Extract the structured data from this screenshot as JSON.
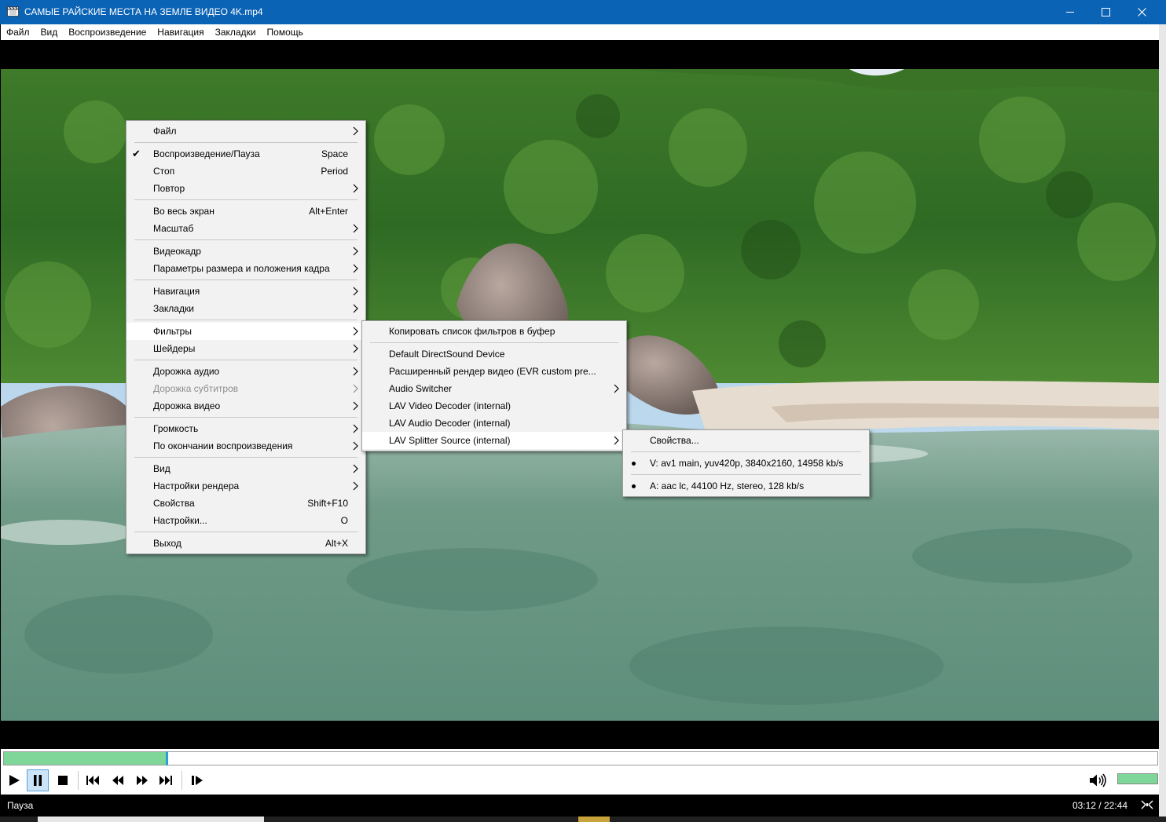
{
  "window": {
    "title": "САМЫЕ РАЙСКИЕ МЕСТА НА ЗЕМЛЕ ВИДЕО 4K.mp4",
    "app_icon": "film-clapper-icon",
    "controls": [
      "minimize-icon",
      "maximize-icon",
      "close-icon"
    ]
  },
  "menubar": {
    "items": [
      "Файл",
      "Вид",
      "Воспроизведение",
      "Навигация",
      "Закладки",
      "Помощь"
    ]
  },
  "context_menu": {
    "items": [
      {
        "label": "Файл",
        "submenu": true
      },
      {
        "label": "Воспроизведение/Пауза",
        "shortcut": "Space",
        "checked": true
      },
      {
        "label": "Стоп",
        "shortcut": "Period"
      },
      {
        "label": "Повтор",
        "submenu": true
      },
      {
        "label": "Во весь экран",
        "shortcut": "Alt+Enter"
      },
      {
        "label": "Масштаб",
        "submenu": true
      },
      {
        "label": "Видеокадр",
        "submenu": true
      },
      {
        "label": "Параметры размера и положения кадра",
        "submenu": true
      },
      {
        "label": "Навигация",
        "submenu": true
      },
      {
        "label": "Закладки",
        "submenu": true
      },
      {
        "label": "Фильтры",
        "submenu": true,
        "highlighted": true
      },
      {
        "label": "Шейдеры",
        "submenu": true
      },
      {
        "label": "Дорожка аудио",
        "submenu": true
      },
      {
        "label": "Дорожка субтитров",
        "submenu": true,
        "disabled": true
      },
      {
        "label": "Дорожка видео",
        "submenu": true
      },
      {
        "label": "Громкость",
        "submenu": true
      },
      {
        "label": "По окончании воспроизведения",
        "submenu": true
      },
      {
        "label": "Вид",
        "submenu": true
      },
      {
        "label": "Настройки рендера",
        "submenu": true
      },
      {
        "label": "Свойства",
        "shortcut": "Shift+F10"
      },
      {
        "label": "Настройки...",
        "shortcut": "O"
      },
      {
        "label": "Выход",
        "shortcut": "Alt+X"
      }
    ]
  },
  "filters_menu": {
    "items": [
      {
        "label": "Копировать список фильтров в буфер"
      },
      {
        "label": "Default DirectSound Device"
      },
      {
        "label": "Расширенный рендер видео (EVR custom pre..."
      },
      {
        "label": "Audio Switcher",
        "submenu": true
      },
      {
        "label": "LAV Video Decoder (internal)"
      },
      {
        "label": "LAV Audio Decoder (internal)"
      },
      {
        "label": "LAV Splitter Source (internal)",
        "submenu": true,
        "highlighted": true
      }
    ]
  },
  "splitter_menu": {
    "items": [
      {
        "label": "Свойства..."
      },
      {
        "label": "V: av1 main, yuv420p, 3840x2160, 14958 kb/s",
        "selected": true
      },
      {
        "label": "A: aac lc, 44100 Hz, stereo, 128 kb/s",
        "selected": true
      }
    ]
  },
  "player": {
    "progress_fraction": 0.14,
    "volume_fraction": 1.0,
    "buttons": [
      "play-icon",
      "pause-icon",
      "stop-icon",
      "skip-previous-icon",
      "rewind-icon",
      "fast-forward-icon",
      "skip-next-icon",
      "frame-step-icon"
    ],
    "volume_icon": "speaker-volume-icon"
  },
  "status": {
    "state": "Пауза",
    "time": "03:12 / 22:44",
    "network_icon": "network-status-icon"
  },
  "colors": {
    "titlebar": "#0b63b6",
    "progress_fill": "#7fd699",
    "progress_thumb": "#2a9fd6",
    "menu_bg": "#f2f2f2"
  }
}
